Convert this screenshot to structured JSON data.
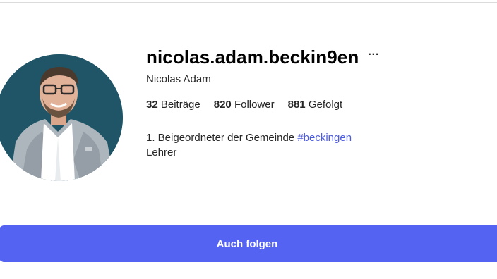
{
  "profile": {
    "username": "nicolas.adam.beckin9en",
    "more_label": "···",
    "full_name": "Nicolas Adam",
    "stats": {
      "posts_count": "32",
      "posts_label": "Beiträge",
      "followers_count": "820",
      "followers_label": "Follower",
      "following_count": "881",
      "following_label": "Gefolgt"
    },
    "bio": {
      "line1_text": "1. Beigeordneter der Gemeinde ",
      "line1_hashtag": "#beckingen",
      "line2": "Lehrer"
    }
  },
  "follow_button": {
    "label": "Auch folgen"
  },
  "colors": {
    "accent": "#5563f2",
    "hashtag": "#4c5be0",
    "avatar_background": "#1f5566"
  }
}
